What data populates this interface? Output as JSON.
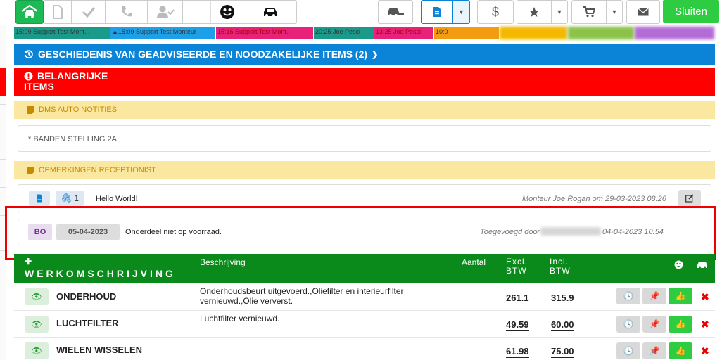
{
  "toolbar": {
    "sluiten_label": "Sluiten"
  },
  "timeline": [
    {
      "label": "15:09 Support Test Mont...",
      "color": "#1a9a8a"
    },
    {
      "label": "15:09 Support Test Monteur",
      "color": "#1ea0e8"
    },
    {
      "label": "15:16 Support Test Mont...",
      "color": "#e8217a"
    },
    {
      "label": "20:25 Joe Pesci",
      "color": "#1a9a8a"
    },
    {
      "label": "13:25 Joe Pesci",
      "color": "#e8217a"
    },
    {
      "label": "10:0",
      "color": "#f39c12"
    }
  ],
  "history_header": "GESCHIEDENIS VAN GEADVISEERDE EN NOODZAKELIJKE ITEMS (2)",
  "important_header_line1": "BELANGRIJKE",
  "important_header_line2": "ITEMS",
  "dms_header": "DMS AUTO NOTITIES",
  "dms_note": "* BANDEN STELLING 2A",
  "receptionist_header": "OPMERKINGEN RECEPTIONIST",
  "receptionist_note": {
    "attachment_count": "1",
    "text": "Hello World!",
    "meta": "Monteur Joe Rogan om 29-03-2023 08:26"
  },
  "parts_note": {
    "badge": "BO",
    "date": "05-04-2023",
    "text": "Onderdeel niet op voorraad.",
    "meta_prefix": "Toegevoegd door",
    "meta_suffix": "04-04-2023 10:54"
  },
  "work": {
    "title": "WERKOMSCHRIJVING",
    "col_description": "Beschrijving",
    "col_amount": "Aantal",
    "col_excl_line1": "Excl.",
    "col_excl_line2": "BTW",
    "col_incl_line1": "Incl.",
    "col_incl_line2": "BTW",
    "rows": [
      {
        "name": "ONDERHOUD",
        "description": "Onderhoudsbeurt uitgevoerd.,Oliefilter en interieurfilter vernieuwd.,Olie ververst.",
        "excl": "261.1",
        "incl": "315.9"
      },
      {
        "name": "LUCHTFILTER",
        "description": "Luchtfilter vernieuwd.",
        "excl": "49.59",
        "incl": "60.00"
      },
      {
        "name": "WIELEN WISSELEN",
        "description": "",
        "excl": "61.98",
        "incl": "75.00"
      }
    ]
  },
  "colors": {
    "brand_green": "#1db954",
    "blue": "#0b84d8",
    "red": "#ff0000",
    "yellow": "#fae8a0",
    "work_green": "#0a8a1a",
    "purple": "#7b2d8e"
  }
}
